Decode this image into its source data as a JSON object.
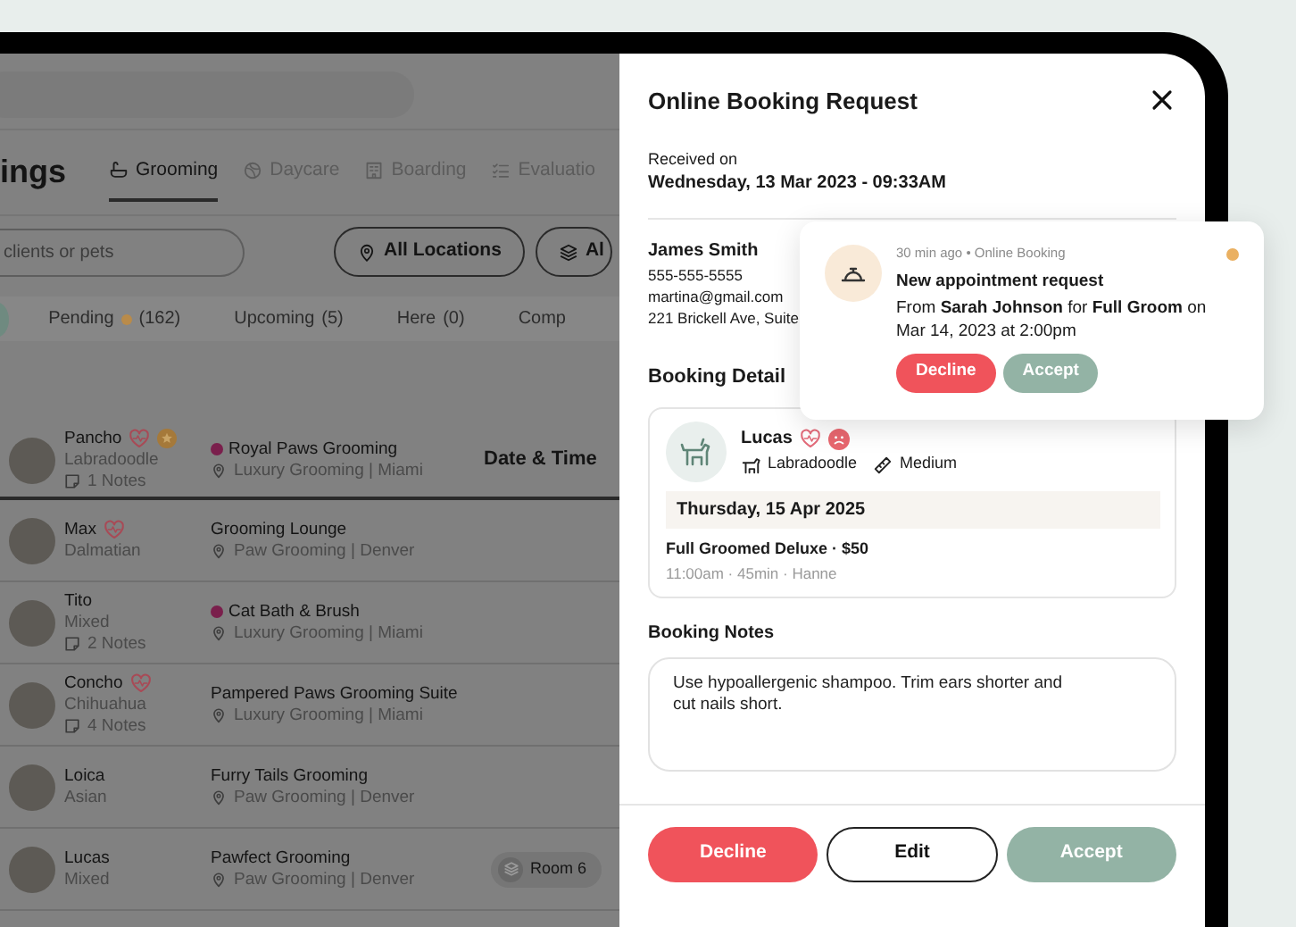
{
  "app": {
    "page_title": "ings",
    "tabs": [
      {
        "label": "Grooming",
        "selected": true
      },
      {
        "label": "Daycare",
        "selected": false
      },
      {
        "label": "Boarding",
        "selected": false
      },
      {
        "label": "Evaluatio",
        "selected": false
      }
    ],
    "search": {
      "placeholder": "clients or pets"
    },
    "filters": [
      {
        "label": "All Locations"
      },
      {
        "label": "Al"
      }
    ],
    "status_tabs": [
      {
        "label": "Pending",
        "count": "(162)",
        "alert": true
      },
      {
        "label": "Upcoming",
        "count": "(5)",
        "alert": false
      },
      {
        "label": "Here",
        "count": "(0)",
        "alert": false
      },
      {
        "label": "Comp",
        "alert": false
      }
    ],
    "column_header": "Date & Time",
    "rows": [
      {
        "name": "Pancho",
        "favorite": true,
        "starred": true,
        "breed": "Labradoodle",
        "notes": "1 Notes",
        "salon": "Royal Paws Grooming",
        "flagged": true,
        "location": "Luxury Grooming | Miami"
      },
      {
        "name": "Max",
        "favorite": true,
        "starred": false,
        "breed": "Dalmatian",
        "salon": "Grooming Lounge",
        "flagged": false,
        "location": "Paw Grooming | Denver"
      },
      {
        "name": "Tito",
        "favorite": false,
        "starred": false,
        "breed": "Mixed",
        "notes": "2 Notes",
        "salon": "Cat Bath & Brush",
        "flagged": true,
        "location": "Luxury Grooming | Miami"
      },
      {
        "name": "Concho",
        "favorite": true,
        "starred": false,
        "breed": "Chihuahua",
        "notes": "4 Notes",
        "salon": "Pampered Paws Grooming Suite",
        "flagged": false,
        "location": "Luxury Grooming | Miami"
      },
      {
        "name": "Loica",
        "favorite": false,
        "starred": false,
        "breed": "Asian",
        "salon": "Furry Tails Grooming",
        "flagged": false,
        "location": "Paw Grooming | Denver"
      },
      {
        "name": "Lucas",
        "favorite": false,
        "starred": false,
        "breed": "Mixed",
        "salon": "Pawfect Grooming",
        "flagged": false,
        "location": "Paw Grooming | Denver",
        "room": "Room 6"
      }
    ]
  },
  "panel": {
    "title": "Online Booking Request",
    "received_label": "Received on",
    "received_at": "Wednesday, 13 Mar 2023 - 09:33AM",
    "client": {
      "name": "James Smith",
      "phone": "555-555-5555",
      "email": "martina@gmail.com",
      "address": "221 Brickell Ave, Suite"
    },
    "detail_heading": "Booking Detail",
    "pet": {
      "name": "Lucas",
      "favorite": true,
      "alert": true,
      "breed": "Labradoodle",
      "size": "Medium"
    },
    "date": "Thursday, 15 Apr 2025",
    "service": "Full Groomed Deluxe · $50",
    "service_meta": "11:00am · 45min · Hanne",
    "notes_heading": "Booking Notes",
    "notes": "Use hypoallergenic shampoo. Trim ears shorter and cut nails short.",
    "actions": [
      {
        "label": "Decline",
        "kind": "decline"
      },
      {
        "label": "Edit",
        "kind": "edit"
      },
      {
        "label": "Accept",
        "kind": "accept"
      }
    ]
  },
  "notification": {
    "meta": "30 min ago • Online Booking",
    "title": "New appointment request",
    "body": "From **Sarah Johnson** for **Full Groom** on Mar 14, 2023 at 2:00pm",
    "unread": true,
    "actions": [
      {
        "label": "Decline",
        "kind": "decline"
      },
      {
        "label": "Accept",
        "kind": "accept"
      }
    ]
  }
}
